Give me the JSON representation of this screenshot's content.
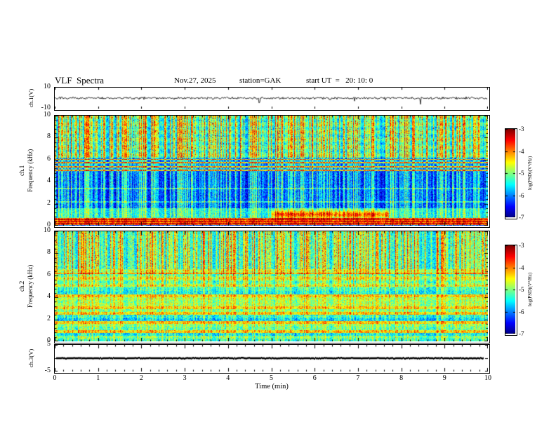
{
  "header": {
    "title": "VLF  Spectra",
    "date": "Nov.27, 2025",
    "station": "station=GAK",
    "start_ut": "start UT  =   20: 10: 0"
  },
  "panels": {
    "ch1_wave": {
      "label": "ch.1(V)",
      "ymax": "10",
      "ymin": "-10"
    },
    "spec1": {
      "channel": "ch.1",
      "axis": "Frequency (kHz)",
      "yticks": [
        "10",
        "8",
        "6",
        "4",
        "2",
        "0"
      ]
    },
    "spec2": {
      "channel": "ch.2",
      "axis": "Frequency (kHz)",
      "yticks": [
        "10",
        "8",
        "6",
        "4",
        "2",
        "0"
      ]
    },
    "ch3": {
      "label": "ch.3(V)",
      "ymax": "5",
      "ymin": "-5"
    }
  },
  "xaxis": {
    "ticks": [
      "0",
      "1",
      "2",
      "3",
      "4",
      "5",
      "6",
      "7",
      "8",
      "9",
      "10"
    ],
    "label": "Time  (min)"
  },
  "colorbar": {
    "label": "log(PSD)(V²/Hz)",
    "ticks": [
      "-3",
      "-4",
      "-5",
      "-6",
      "-7"
    ],
    "zlim": [
      -7,
      -3
    ],
    "colormap": "jet",
    "colormap_colors": [
      "#00008f",
      "#0000ff",
      "#00ffff",
      "#00ff00",
      "#ffff00",
      "#ff0000",
      "#7f0000"
    ]
  },
  "chart_data": [
    {
      "type": "line",
      "name": "ch1-waveform",
      "ylabel": "ch.1(V)",
      "xlabel": "Time (min)",
      "xlim": [
        0,
        10
      ],
      "ylim": [
        -10,
        10
      ],
      "description": "Black noisy trace centered near 0 V, amplitude mostly within ±2 V, with sporadic impulsive spikes up to about ±8 V across the full 10 minutes."
    },
    {
      "type": "heatmap",
      "name": "ch1-spectrogram",
      "ylabel": "Frequency (kHz)",
      "xlabel": "Time (min)",
      "xlim": [
        0,
        10
      ],
      "ylim": [
        0,
        10
      ],
      "colorbar_label": "log(PSD)(V²/Hz)",
      "zlim": [
        -7,
        -3
      ],
      "features": [
        "dense vertical broadband impulses (sferics) spanning 0-10 kHz for the whole interval",
        "intense red/yellow band below ~1 kHz",
        "dark blue quiet band between ~1.5 and 5 kHz",
        "several narrow cyan horizontal lines near 5-6 kHz",
        "green/yellow speckled noise above 6 kHz",
        "orange enhancement near 1 kHz between ~5 and 7.5 min"
      ]
    },
    {
      "type": "heatmap",
      "name": "ch2-spectrogram",
      "ylabel": "Frequency (kHz)",
      "xlabel": "Time (min)",
      "xlim": [
        0,
        10
      ],
      "ylim": [
        0,
        10
      ],
      "colorbar_label": "log(PSD)(V²/Hz)",
      "zlim": [
        -7,
        -3
      ],
      "features": [
        "horizontal cyan/blue banding below ~5 kHz",
        "bright green band around 5-6.5 kHz",
        "dense vertical broadband impulses throughout",
        "red specks above 6 kHz at strong impulse times"
      ]
    },
    {
      "type": "line",
      "name": "ch3-waveform",
      "ylabel": "ch.3(V)",
      "xlabel": "Time (min)",
      "xlim": [
        0,
        10
      ],
      "ylim": [
        -5,
        5
      ],
      "description": "Flat thick dark trace at 0 V for the entire interval."
    }
  ]
}
